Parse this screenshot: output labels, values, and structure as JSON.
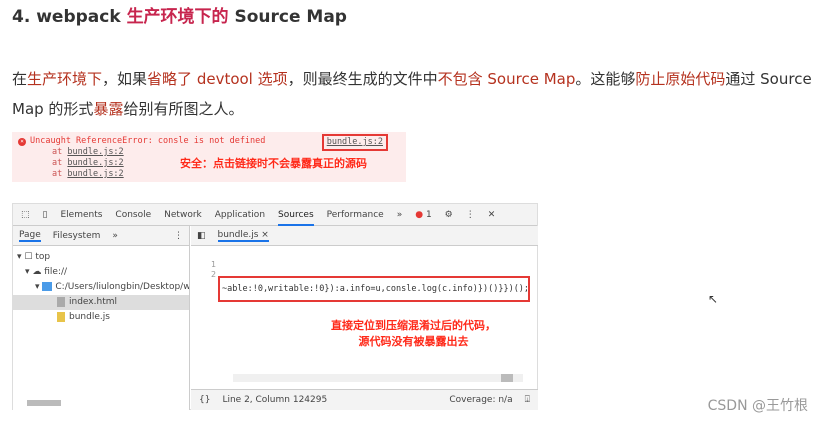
{
  "heading": {
    "prefix": "4. webpack ",
    "highlight": "生产环境下的",
    "suffix": " Source Map"
  },
  "paragraph": [
    {
      "t": "在",
      "r": false
    },
    {
      "t": "生产环境下",
      "r": true
    },
    {
      "t": "，如果",
      "r": false
    },
    {
      "t": "省略了 devtool 选项",
      "r": true
    },
    {
      "t": "，则最终生成的文件中",
      "r": false
    },
    {
      "t": "不包含 Source Map",
      "r": true
    },
    {
      "t": "。这能够",
      "r": false
    },
    {
      "t": "防止原始代码",
      "r": true
    },
    {
      "t": "通过 Source Map 的形式",
      "r": false
    },
    {
      "t": "暴露",
      "r": true
    },
    {
      "t": "给别有所图之人。",
      "r": false
    }
  ],
  "console_error": {
    "message": "Uncaught ReferenceError: consle is not defined",
    "link": "bundle.js:2",
    "stack": [
      "bundle.js:2",
      "bundle.js:2",
      "bundle.js:2"
    ],
    "at": "at",
    "note": "安全：点击链接时不会暴露真正的源码"
  },
  "devtools": {
    "tabs": [
      "Elements",
      "Console",
      "Network",
      "Application",
      "Sources",
      "Performance"
    ],
    "more": "»",
    "error_count": "1",
    "sub_tabs": [
      "Page",
      "Filesystem"
    ],
    "tree": {
      "top": "top",
      "origin": "file://",
      "folder": "C:/Users/liulongbin/Desktop/w",
      "files": [
        "index.html",
        "bundle.js"
      ]
    },
    "open_file": "bundle.js",
    "line_numbers": [
      "1",
      "2"
    ],
    "code": "~able:!0,writable:!0}):a.info=u,consle.log(c.info)})()}})();",
    "note": [
      "直接定位到压缩混淆过后的代码，",
      "源代码没有被暴露出去"
    ],
    "status_pos": "Line 2, Column 124295",
    "coverage": "Coverage: n/a"
  },
  "watermark": "CSDN @王竹根"
}
